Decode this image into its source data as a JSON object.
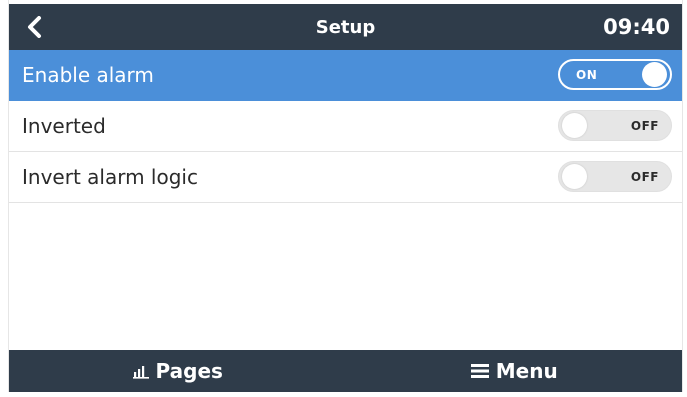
{
  "header": {
    "back_icon": "chevron-left-icon",
    "title": "Setup",
    "clock": "09:40"
  },
  "settings": [
    {
      "label": "Enable alarm",
      "state": "ON",
      "enabled": true,
      "selected": true
    },
    {
      "label": "Inverted",
      "state": "OFF",
      "enabled": false,
      "selected": false
    },
    {
      "label": "Invert alarm logic",
      "state": "OFF",
      "enabled": false,
      "selected": false
    }
  ],
  "footer": {
    "pages_label": "Pages",
    "pages_icon": "bar-chart-icon",
    "menu_label": "Menu",
    "menu_icon": "hamburger-menu-icon"
  },
  "colors": {
    "bar_background": "#2f3c4a",
    "selected_row": "#4b8fd9",
    "toggle_off": "#e6e6e6"
  }
}
